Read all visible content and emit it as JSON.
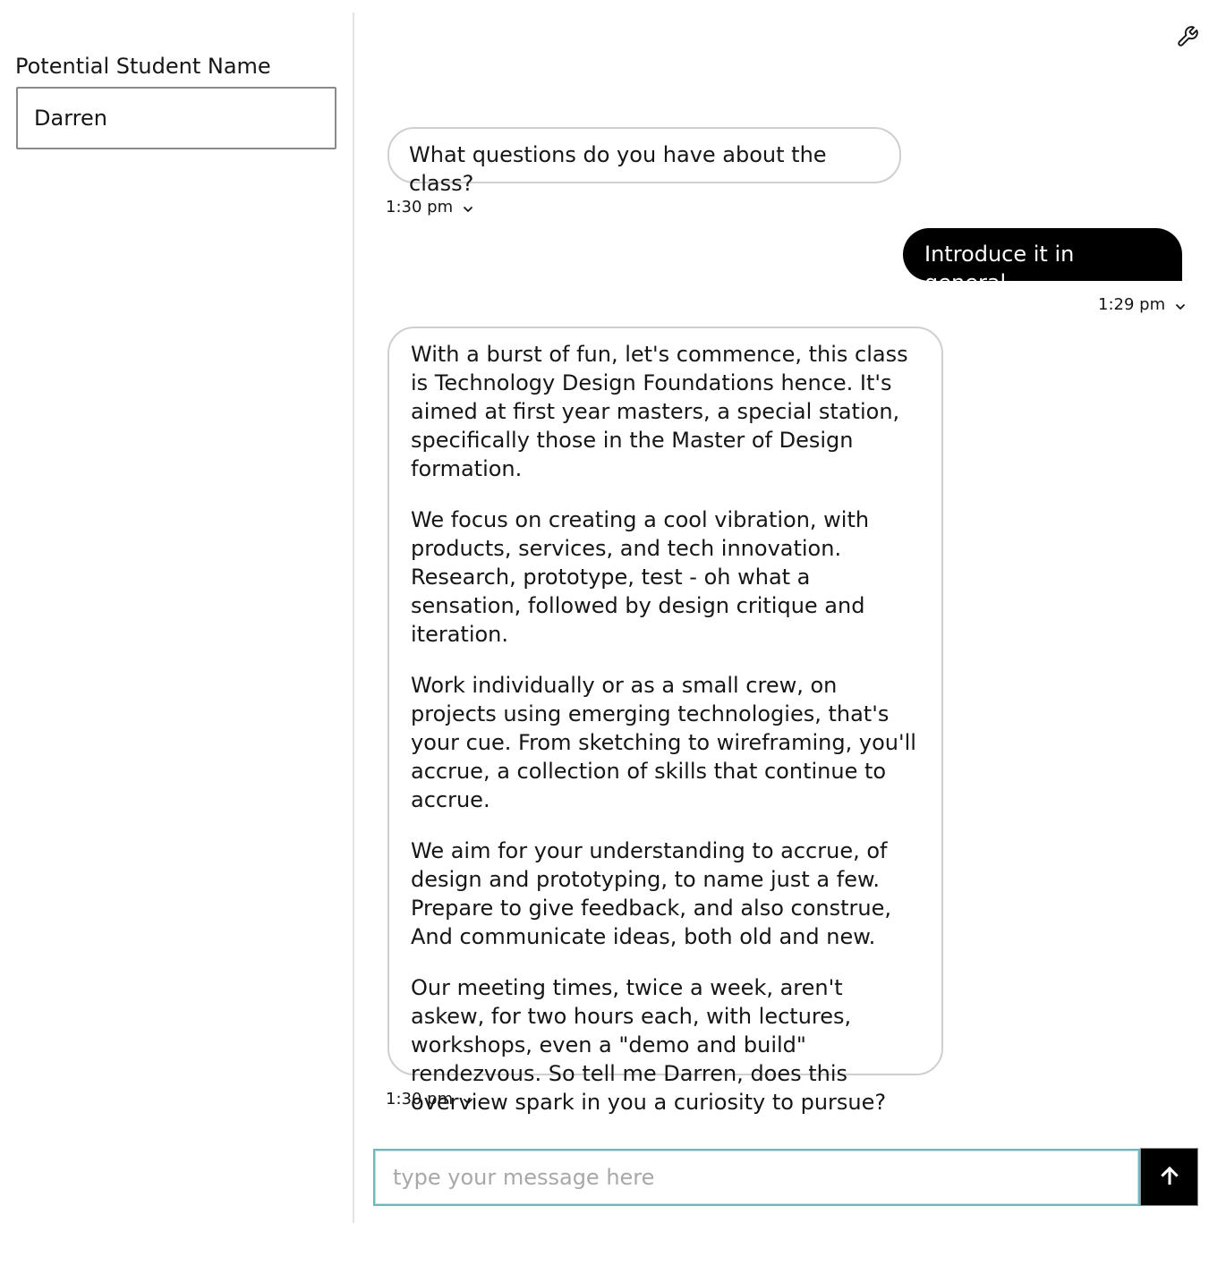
{
  "sidebar": {
    "student_name_label": "Potential Student Name",
    "student_name_value": "Darren"
  },
  "header": {
    "settings_icon": "wrench-icon"
  },
  "messages": [
    {
      "role": "assistant",
      "text": "What questions do you have about the class?",
      "time": "1:30 pm"
    },
    {
      "role": "user",
      "text": "Introduce it in general.",
      "time": "1:29 pm"
    },
    {
      "role": "assistant",
      "paragraphs": [
        "With a burst of fun, let's commence, this class is Technology Design Foundations hence. It's aimed at first year masters, a special station, specifically those in the Master of Design formation.",
        "We focus on creating a cool vibration, with products, services, and tech innovation. Research, prototype, test - oh what a sensation, followed by design critique and iteration.",
        "Work individually or as a small crew, on projects using emerging technologies, that's your cue. From sketching to wireframing, you'll accrue, a collection of skills that continue to accrue.",
        "We aim for your understanding to accrue, of design and prototyping, to name just a few. Prepare to give feedback, and also construe, And communicate ideas, both old and new.",
        "Our meeting times, twice a week, aren't askew, for two hours each, with lectures, workshops, even a \"demo and build\" rendezvous. So tell me Darren, does this overview spark in you a curiosity to pursue?"
      ],
      "time": "1:30 pm"
    }
  ],
  "composer": {
    "placeholder": "type your message here",
    "value": "",
    "send_icon": "arrow-up-icon"
  },
  "colors": {
    "user_bubble": "#000000",
    "bot_bubble_border": "#cfcfcf",
    "input_focus_border": "#6fb7bd",
    "send_button": "#000000"
  }
}
